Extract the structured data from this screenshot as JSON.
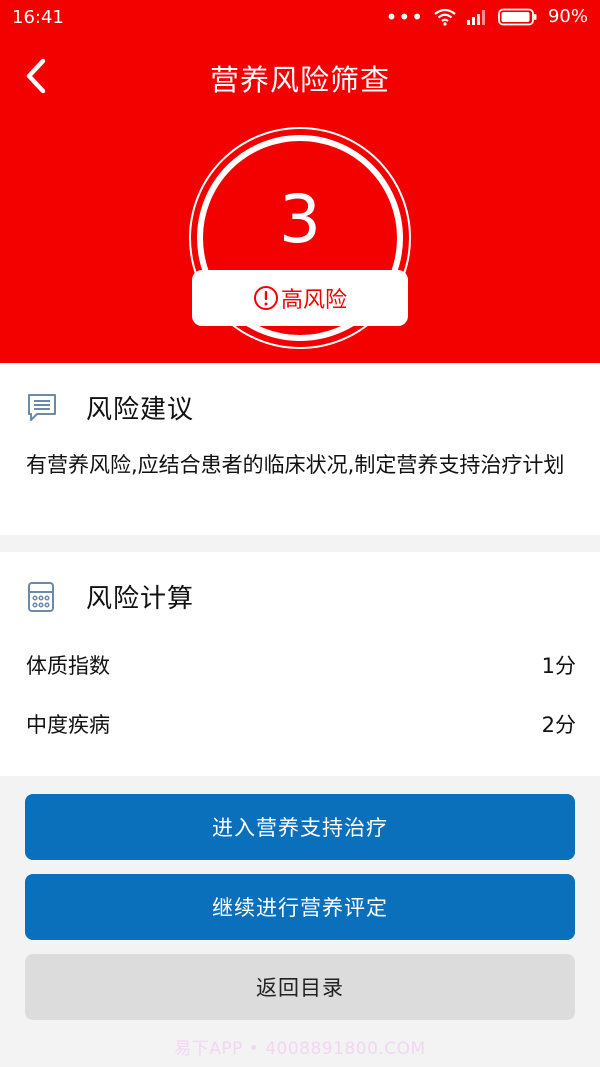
{
  "status_bar": {
    "time": "16:41",
    "dots": "•••",
    "battery_percent": "90%"
  },
  "nav": {
    "title": "营养风险筛查",
    "back_icon": "chevron-left-icon"
  },
  "score": {
    "value": "3",
    "risk_label": "高风险",
    "risk_icon": "alert-circle-icon"
  },
  "advice": {
    "title": "风险建议",
    "icon": "chat-bubble-icon",
    "text": "有营养风险,应结合患者的临床状况,制定营养支持治疗计划"
  },
  "calculation": {
    "title": "风险计算",
    "icon": "calculator-icon",
    "rows": [
      {
        "label": "体质指数",
        "value": "1分"
      },
      {
        "label": "中度疾病",
        "value": "2分"
      }
    ]
  },
  "actions": {
    "enter_support": "进入营养支持治疗",
    "continue_assessment": "继续进行营养评定",
    "back_to_menu": "返回目录"
  },
  "watermark": "易下APP • 4008891800.COM",
  "colors": {
    "hero_red": "#f30000",
    "primary_blue": "#0a70bc",
    "secondary_gray": "#dcdcdc"
  }
}
